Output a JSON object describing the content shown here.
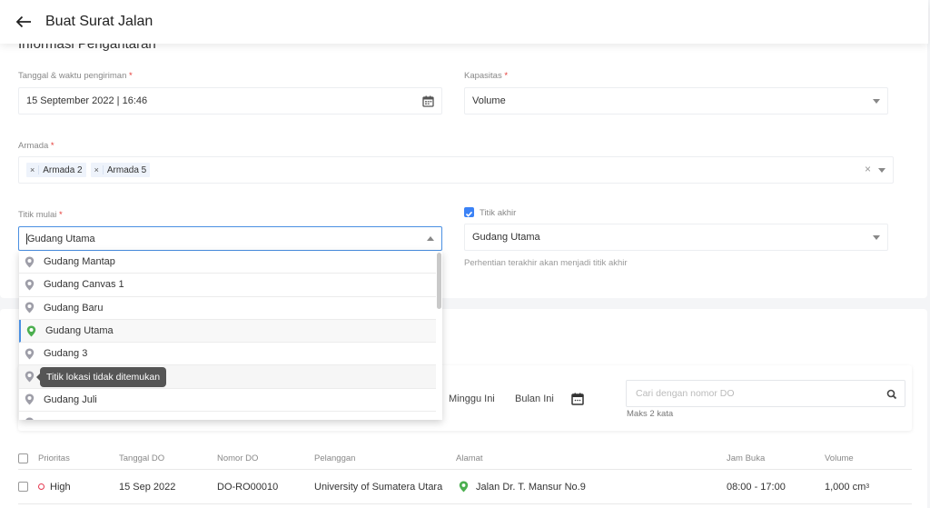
{
  "header": {
    "title": "Buat Surat Jalan",
    "back_icon": "arrow-left-icon"
  },
  "form": {
    "section_title": "Informasi Pengantaran",
    "required_mark": "*",
    "tanggal": {
      "label": "Tanggal & waktu pengiriman",
      "value": "15 September 2022 | 16:46",
      "icon": "calendar-icon"
    },
    "kapasitas": {
      "label": "Kapasitas",
      "value": "Volume"
    },
    "armada": {
      "label": "Armada",
      "tags": [
        "Armada 2",
        "Armada 5"
      ],
      "remove_glyph": "×",
      "clear_glyph": "×"
    },
    "titik_mulai": {
      "label": "Titik mulai",
      "value": "Gudang Utama"
    },
    "titik_akhir": {
      "label": "Titik akhir",
      "checked": true,
      "value": "Gudang Utama",
      "hint": "Perhentian terakhir akan menjadi titik akhir"
    }
  },
  "dropdown": {
    "options": [
      {
        "label": "Gudang Mantap",
        "status": "gray"
      },
      {
        "label": "Gudang Canvas 1",
        "status": "gray"
      },
      {
        "label": "Gudang Baru",
        "status": "gray"
      },
      {
        "label": "Gudang Utama",
        "status": "green",
        "selected": true
      },
      {
        "label": "Gudang 3",
        "status": "gray"
      },
      {
        "label": "",
        "status": "gray",
        "hovered": true
      },
      {
        "label": "Gudang Juli",
        "status": "gray"
      },
      {
        "label": "",
        "status": "gray"
      }
    ],
    "tooltip": "Titik lokasi tidak ditemukan"
  },
  "filters": {
    "tabs": [
      "Minggu Ini",
      "Bulan Ini"
    ],
    "calendar_icon": "calendar-icon",
    "search_placeholder": "Cari dengan nomor DO",
    "search_hint": "Maks 2 kata"
  },
  "table": {
    "columns": [
      "Prioritas",
      "Tanggal DO",
      "Nomor DO",
      "Pelanggan",
      "Alamat",
      "Jam Buka",
      "Volume"
    ],
    "rows": [
      {
        "prioritas": "High",
        "tanggal": "15 Sep 2022",
        "nomor": "DO-RO00010",
        "pelanggan": "University of Sumatera Utara",
        "alamat": "Jalan Dr. T. Mansur No.9",
        "jam_buka": "08:00 - 17:00",
        "volume": "1,000 cm",
        "volume_unit_sup": "3"
      }
    ]
  },
  "colors": {
    "accent": "#4a90e2",
    "required": "#e53935",
    "pin_green": "#4caf50",
    "pin_gray": "#9e9ea8",
    "priority_high": "#e53950"
  }
}
